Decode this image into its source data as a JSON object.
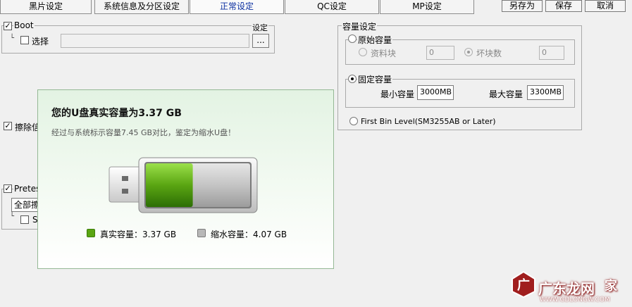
{
  "tabs": [
    {
      "label": "黑片设定"
    },
    {
      "label": "系统信息及分区设定"
    },
    {
      "label": "正常设定"
    },
    {
      "label": "QC设定"
    },
    {
      "label": "MP设定"
    }
  ],
  "actions": {
    "save_as": "另存为",
    "save": "保存",
    "cancel": "取消"
  },
  "boot": {
    "label": "Boot",
    "checked": true,
    "select_label": "选择",
    "select_checked": false,
    "path_value": "",
    "browse_label": "...",
    "settings_label": "设定"
  },
  "erase": {
    "label": "擦除信",
    "checked": true
  },
  "pretest": {
    "label": "Pretest",
    "checked": true,
    "dropdown_value": "全部擦",
    "sub_label": "S",
    "sub_checked": false
  },
  "capacity": {
    "group_label": "容量设定",
    "original": {
      "label": "原始容量",
      "selected": false,
      "data_block_label": "资料块",
      "data_block_value": "0",
      "bad_block_label": "坏块数",
      "bad_block_value": "0"
    },
    "fixed": {
      "label": "固定容量",
      "selected": true,
      "min_label": "最小容量",
      "min_value": "3000MB",
      "max_label": "最大容量",
      "max_value": "3300MB"
    },
    "first_bin": {
      "label": "First Bin Level(SM3255AB or Later)",
      "selected": false
    }
  },
  "popup": {
    "title": "您的U盘真实容量为3.37 GB",
    "description": "经过与系统标示容量7.45 GB对比，鉴定为缩水U盘！",
    "real_label": "真实容量：3.37 GB",
    "shrink_label": "缩水容量：4.07 GB",
    "real_fraction": 0.45,
    "colors": {
      "real": "#5aa512",
      "shrink": "#b8b8b8"
    }
  },
  "watermark": {
    "text": "广东龙网",
    "suffix": "家",
    "url": "WWW.GDLONGW.COM"
  }
}
